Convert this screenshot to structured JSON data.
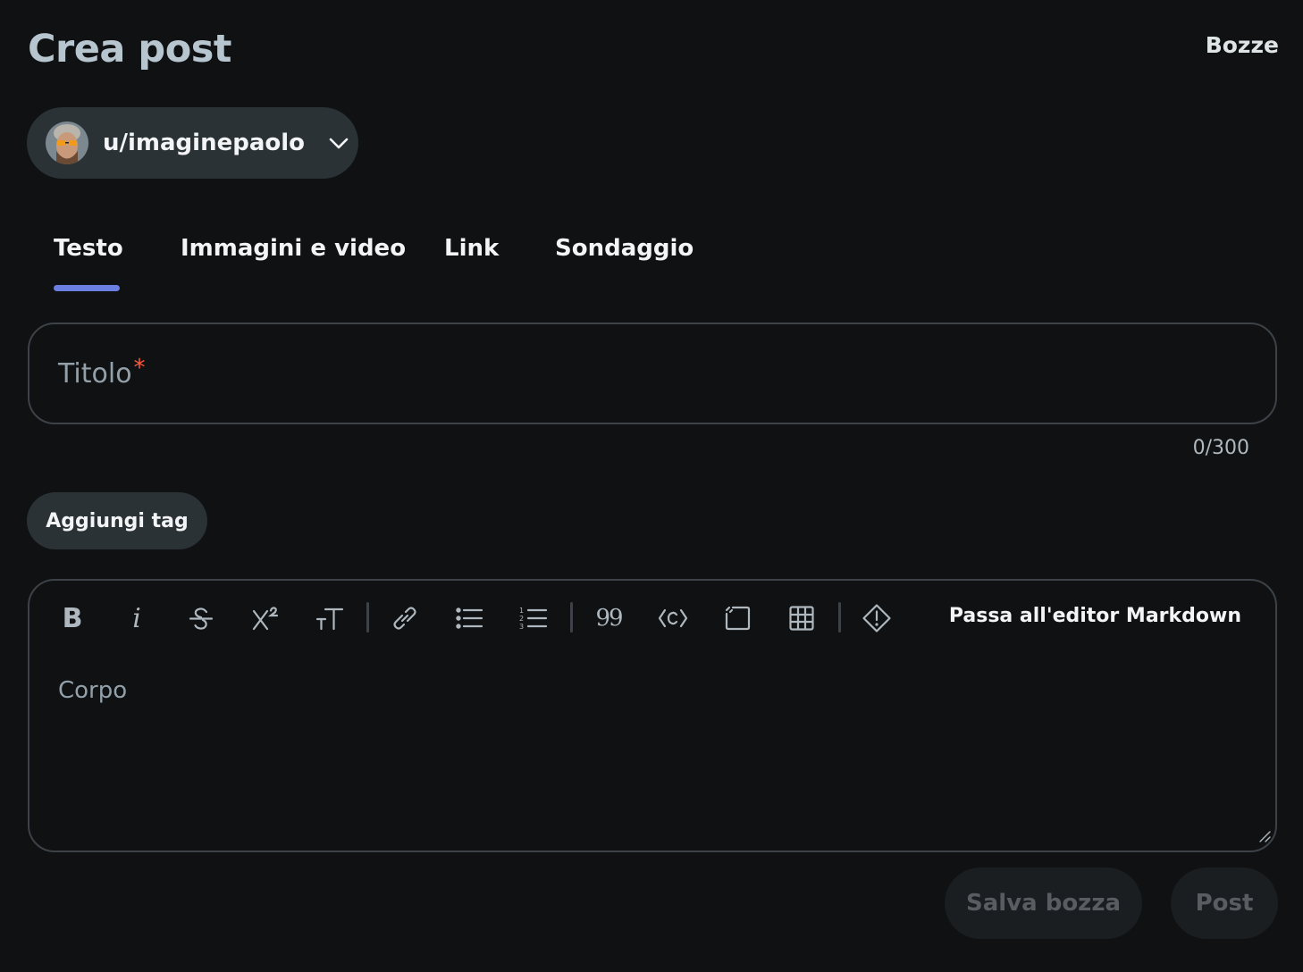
{
  "header": {
    "title": "Crea post",
    "drafts_link": "Bozze"
  },
  "community_picker": {
    "label": "u/imaginepaolo",
    "icon": "chevron-down-icon"
  },
  "tabs": [
    {
      "label": "Testo",
      "active": true
    },
    {
      "label": "Immagini e video",
      "active": false
    },
    {
      "label": "Link",
      "active": false
    },
    {
      "label": "Sondaggio",
      "active": false
    }
  ],
  "title_field": {
    "placeholder": "Titolo",
    "required_marker": "*",
    "char_count": "0/300"
  },
  "add_tag_label": "Aggiungi tag",
  "editor": {
    "toolbar": [
      {
        "name": "bold-icon",
        "glyph": "B"
      },
      {
        "name": "italic-icon",
        "glyph": "i"
      },
      {
        "name": "strikethrough-icon"
      },
      {
        "name": "superscript-icon"
      },
      {
        "name": "heading-icon"
      },
      {
        "name": "link-icon"
      },
      {
        "name": "bulleted-list-icon"
      },
      {
        "name": "numbered-list-icon"
      },
      {
        "name": "quote-icon",
        "glyph": "99"
      },
      {
        "name": "code-icon"
      },
      {
        "name": "code-block-icon"
      },
      {
        "name": "table-icon"
      },
      {
        "name": "spoiler-icon"
      }
    ],
    "markdown_switch": "Passa all'editor Markdown",
    "body_placeholder": "Corpo"
  },
  "actions": {
    "save_draft": "Salva bozza",
    "post": "Post",
    "enabled": false
  },
  "colors": {
    "background": "#0f1113",
    "accent": "#6a7fe0",
    "required": "#ff5a3c",
    "control_bg": "#2a3236"
  }
}
